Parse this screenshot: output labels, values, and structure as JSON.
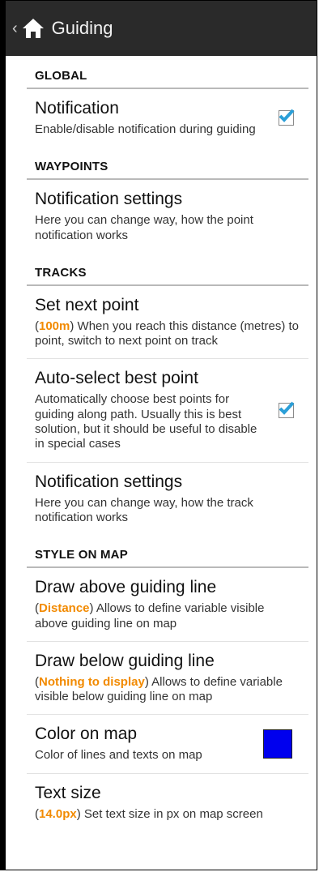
{
  "header": {
    "title": "Guiding",
    "back_icon": "chevron-left-icon",
    "home_icon": "home-icon",
    "background": "#2a2a2a"
  },
  "sections": {
    "global": {
      "label": "GLOBAL"
    },
    "waypoints": {
      "label": "WAYPOINTS"
    },
    "tracks": {
      "label": "TRACKS"
    },
    "style": {
      "label": "STYLE ON MAP"
    }
  },
  "prefs": {
    "notification": {
      "title": "Notification",
      "summary": "Enable/disable notification during guiding",
      "checked": true
    },
    "waypoint_notification_settings": {
      "title": "Notification settings",
      "summary": "Here you can change way, how the point notification works"
    },
    "set_next_point": {
      "title": "Set next point",
      "value": "100m",
      "open": "(",
      "close": ")",
      "summary": " When you reach this distance (metres) to point, switch to next point on track"
    },
    "auto_select": {
      "title": "Auto-select best point",
      "summary": "Automatically choose best points for guiding along path. Usually this is best solution, but it should be useful to disable in special cases",
      "checked": true
    },
    "track_notification_settings": {
      "title": "Notification settings",
      "summary": "Here you can change way, how the track notification works"
    },
    "draw_above": {
      "title": "Draw above guiding line",
      "value": "Distance",
      "open": "(",
      "close": ")",
      "summary": " Allows to define variable visible above guiding line on map"
    },
    "draw_below": {
      "title": "Draw below guiding line",
      "value": "Nothing to display",
      "open": "(",
      "close": ")",
      "summary": " Allows to define variable visible below guiding line on map"
    },
    "color_on_map": {
      "title": "Color on map",
      "summary": "Color of lines and texts on map",
      "color": "#0000ee"
    },
    "text_size": {
      "title": "Text size",
      "value": "14.0px",
      "open": "(",
      "close": ")",
      "summary": " Set text size in px on map screen"
    }
  },
  "colors": {
    "accent_value": "#f28a00",
    "checkmark": "#2b9fd8",
    "divider": "#b9b9b9"
  }
}
